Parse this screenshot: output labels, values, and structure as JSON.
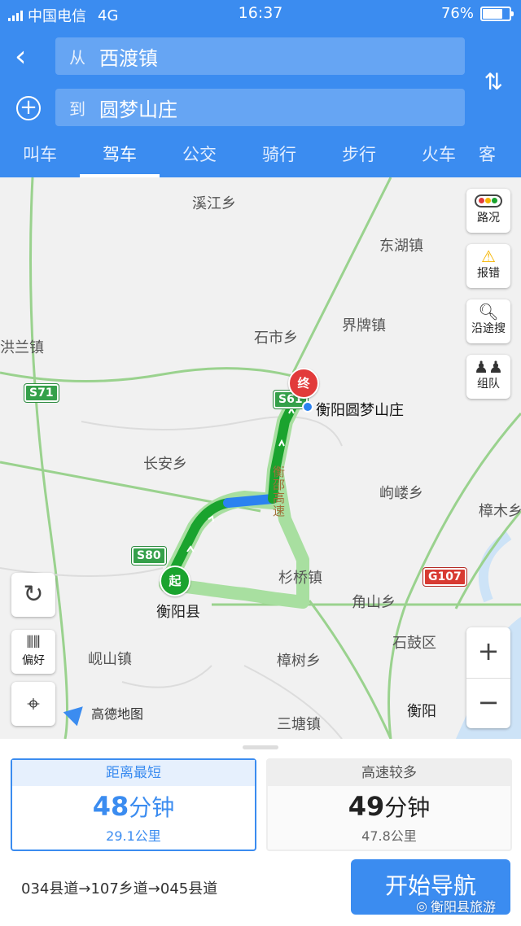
{
  "status": {
    "carrier": "中国电信",
    "network": "4G",
    "time": "16:37",
    "battery": "76%"
  },
  "search": {
    "from_prefix": "从",
    "from_value": "西渡镇",
    "to_prefix": "到",
    "to_value": "圆梦山庄"
  },
  "tabs": [
    "叫车",
    "驾车",
    "公交",
    "骑行",
    "步行",
    "火车",
    "客"
  ],
  "active_tab": "驾车",
  "map": {
    "places": [
      "溪江乡",
      "东湖镇",
      "界牌镇",
      "石市乡",
      "洪兰镇",
      "长安乡",
      "岣嵝乡",
      "樟木乡",
      "杉桥镇",
      "角山乡",
      "石鼓区",
      "衡阳",
      "衡阳县",
      "岘山镇",
      "樟树乡",
      "三塘镇",
      "衡阳圆梦山庄"
    ],
    "roads": [
      "S71",
      "S61",
      "S80",
      "G107"
    ],
    "highway_label": "衡邵高速",
    "start_label": "起",
    "end_label": "终",
    "logo": "高德地图",
    "side_buttons": [
      "路况",
      "报错",
      "沿途搜",
      "组队"
    ],
    "pref_label": "偏好",
    "zoom_in": "+",
    "zoom_out": "−"
  },
  "routes": [
    {
      "tag": "距离最短",
      "minutes": "48",
      "unit": "分钟",
      "distance": "29.1公里"
    },
    {
      "tag": "高速较多",
      "minutes": "49",
      "unit": "分钟",
      "distance": "47.8公里"
    }
  ],
  "route_desc": "034县道→107乡道→045县道",
  "start_nav": "开始导航",
  "watermark": "衡阳县旅游",
  "colors": {
    "primary": "#3b8cf0",
    "route_green": "#1aa32e",
    "route_blue": "#2b82f0",
    "end_red": "#e23b3b"
  }
}
